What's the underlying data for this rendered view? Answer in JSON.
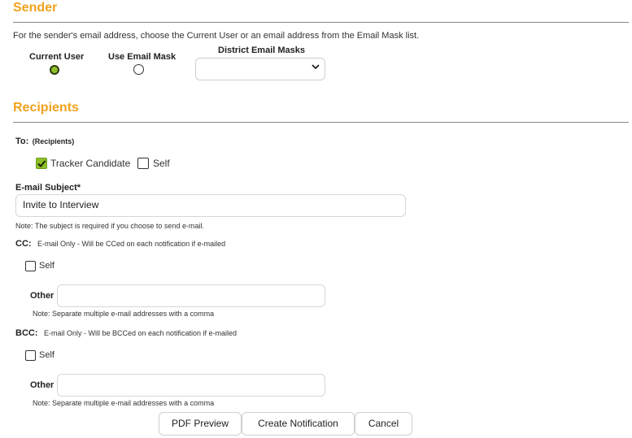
{
  "sender": {
    "title": "Sender",
    "instruction": "For the sender's email address, choose the Current User or an email address from the Email Mask list.",
    "current_user_label": "Current User",
    "use_email_mask_label": "Use Email Mask",
    "district_masks_label": "District Email Masks",
    "district_masks_value": "",
    "selected": "Current User"
  },
  "recipients": {
    "title": "Recipients",
    "to_label": "To:",
    "to_sub": "(Recipients)",
    "tracker_candidate_label": "Tracker Candidate",
    "tracker_candidate_checked": true,
    "self_label": "Self",
    "self_checked": false
  },
  "subject": {
    "label": "E-mail Subject*",
    "value": "Invite to Interview",
    "note": "Note: The subject is required if you choose to send e-mail."
  },
  "cc": {
    "label": "CC:",
    "description": "E-mail Only - Will be CCed on each notification if e-mailed",
    "self_label": "Self",
    "self_checked": false,
    "other_label": "Other",
    "other_value": "",
    "note": "Note: Separate multiple e-mail addresses with a comma"
  },
  "bcc": {
    "label": "BCC:",
    "description": "E-mail Only - Will be BCCed on each notification if e-mailed",
    "self_label": "Self",
    "self_checked": false,
    "other_label": "Other",
    "other_value": "",
    "note": "Note: Separate multiple e-mail addresses with a comma"
  },
  "actions": {
    "pdf_preview": "PDF Preview",
    "create_notification": "Create Notification",
    "cancel": "Cancel"
  },
  "colors": {
    "section_title": "#f0a21d",
    "checked_fill": "#8dbf2a"
  },
  "icons": {
    "select_arrow": "chevron-down-icon",
    "check": "checkmark-icon"
  }
}
